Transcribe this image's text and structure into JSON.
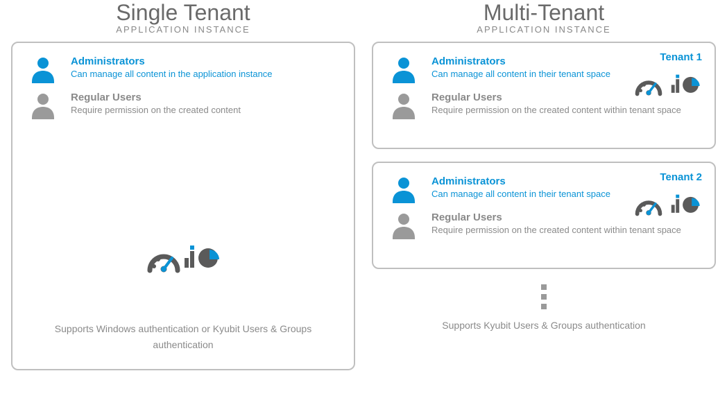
{
  "colors": {
    "accent": "#0a93d6",
    "muted": "#8a8a8a",
    "icon_gray": "#5a5a5a"
  },
  "left": {
    "title": "Single Tenant",
    "subtitle": "APPLICATION INSTANCE",
    "admin": {
      "title": "Administrators",
      "desc": "Can manage all content in the application instance"
    },
    "regular": {
      "title": "Regular Users",
      "desc": "Require permission on the created content"
    },
    "footer": "Supports Windows authentication or Kyubit Users & Groups authentication"
  },
  "right": {
    "title": "Multi-Tenant",
    "subtitle": "APPLICATION INSTANCE",
    "tenants": [
      {
        "badge": "Tenant 1",
        "admin": {
          "title": "Administrators",
          "desc": "Can manage all content in their tenant space"
        },
        "regular": {
          "title": "Regular Users",
          "desc": "Require permission on the created content within tenant space"
        }
      },
      {
        "badge": "Tenant 2",
        "admin": {
          "title": "Administrators",
          "desc": "Can manage all content in their tenant space"
        },
        "regular": {
          "title": "Regular Users",
          "desc": "Require permission on the created content within tenant space"
        }
      }
    ],
    "footer": "Supports Kyubit Users & Groups authentication"
  },
  "icons": {
    "user": "user-icon",
    "gauge": "dashboard-gauge-icon",
    "chart": "pie-bar-chart-icon"
  }
}
